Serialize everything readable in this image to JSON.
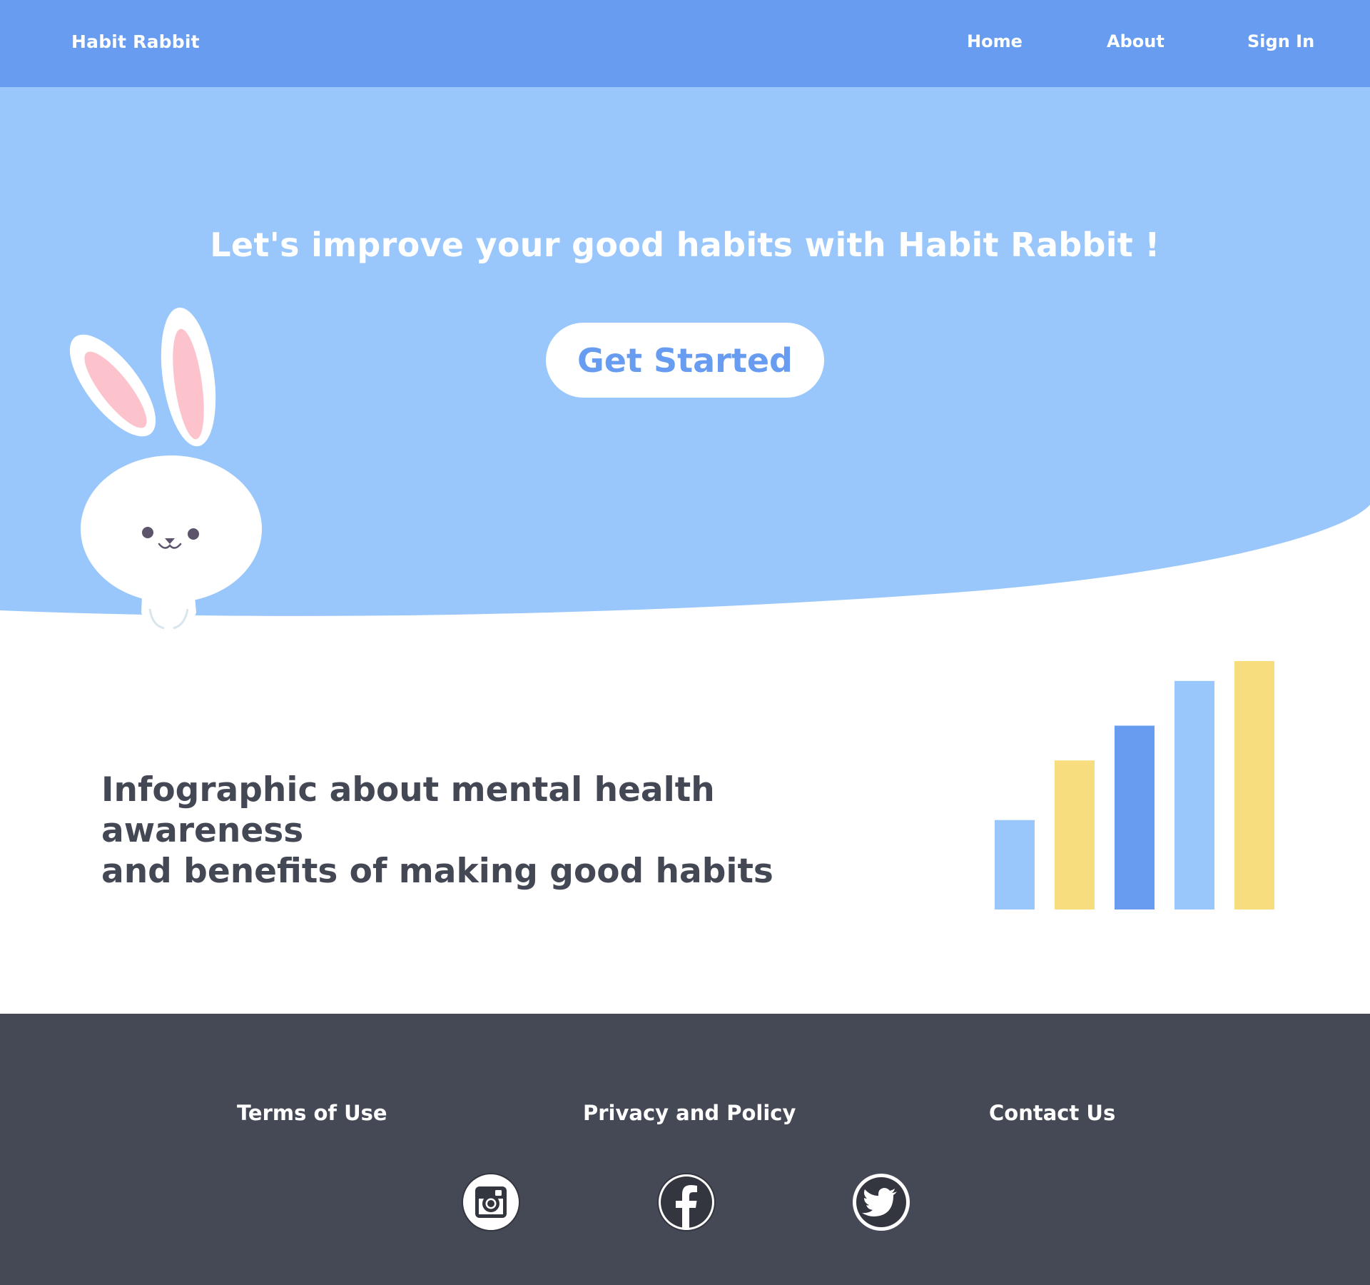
{
  "header": {
    "brand": "Habit Rabbit",
    "nav": {
      "home": "Home",
      "about": "About",
      "sign_in": "Sign In"
    }
  },
  "hero": {
    "title": "Let's improve your good habits with Habit Rabbit !",
    "cta_label": "Get Started",
    "illustration": "rabbit-mascot"
  },
  "infographic": {
    "heading_line1": "Infographic about mental health awareness",
    "heading_line2": "and benefits of making good habits",
    "chart_data": {
      "type": "bar",
      "values": [
        36,
        60,
        74,
        92,
        100
      ],
      "colors": [
        "#99C7FC",
        "#F7DD7D",
        "#689CF0",
        "#99C7FC",
        "#F7DD7D"
      ]
    }
  },
  "footer": {
    "links": {
      "terms": "Terms of Use",
      "privacy": "Privacy and Policy",
      "contact": "Contact Us"
    },
    "social": [
      "instagram-icon",
      "facebook-icon",
      "twitter-icon"
    ]
  },
  "colors": {
    "nav_bg": "#689CF0",
    "hero_bg": "#99C7FC",
    "accent_blue": "#689CF0",
    "accent_yellow": "#F7DD7D",
    "text_dark": "#444854",
    "footer_bg": "#454955"
  }
}
